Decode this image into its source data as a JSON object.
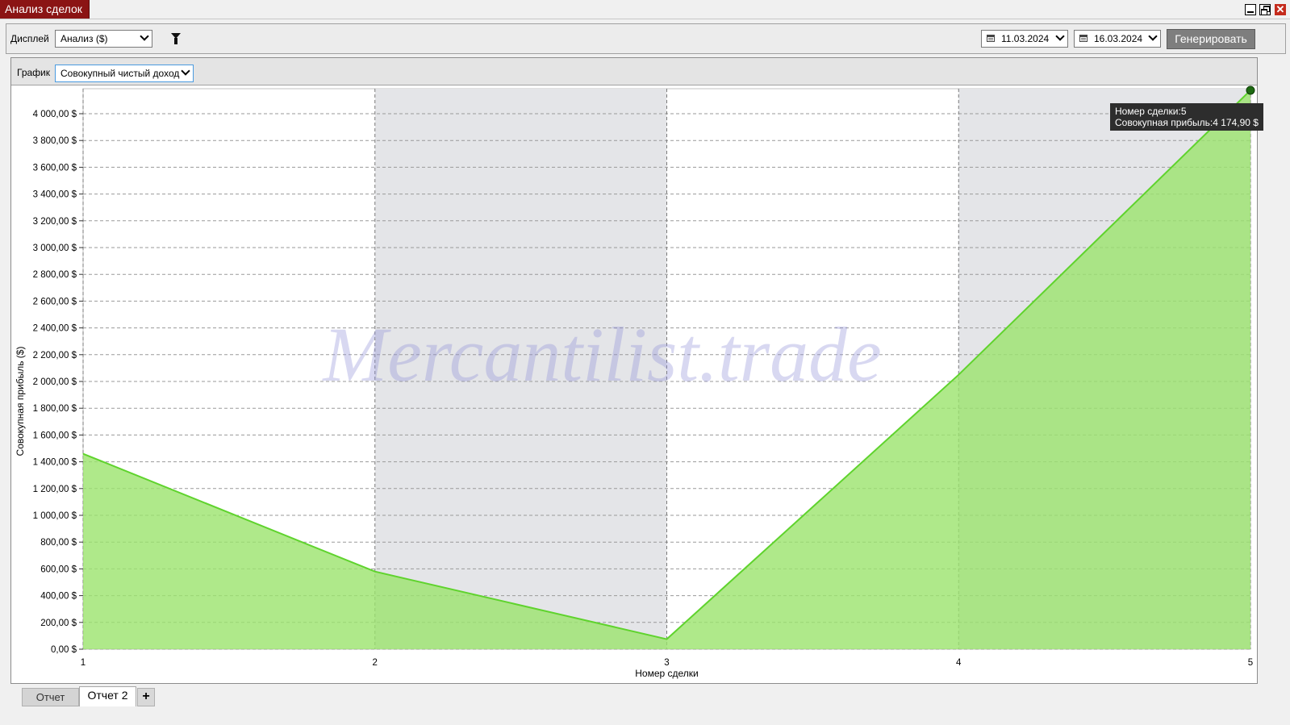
{
  "window": {
    "title": "Анализ сделок",
    "close_glyph": "✕"
  },
  "toolbar": {
    "display_label": "Дисплей",
    "display_value": "Анализ ($)",
    "date_from": "11.03.2024",
    "date_to": "16.03.2024",
    "generate_label": "Генерировать"
  },
  "chart_header": {
    "chart_label": "График",
    "chart_value": "Совокупный чистый доход"
  },
  "tooltip": {
    "line1": "Номер сделки:5",
    "line2": "Совокупная прибыль:4 174,90 $"
  },
  "watermark": "Mercantilist.trade",
  "colors": {
    "fill": "#9be36d",
    "line": "#5fd32d",
    "band": "#e4e5e8",
    "accent": "#8b1414",
    "point": "#1e6b12"
  },
  "chart_data": {
    "type": "area",
    "x": [
      1,
      2,
      3,
      4,
      5
    ],
    "series": [
      {
        "values": [
          1460,
          580,
          75,
          2050,
          4174.9
        ]
      }
    ],
    "xlabel": "Номер сделки",
    "ylabel": "Совокупная прибыль ($)",
    "ylim": [
      0,
      4000
    ],
    "xlim": [
      1,
      5
    ],
    "yticks": [
      0,
      200,
      400,
      600,
      800,
      1000,
      1200,
      1400,
      1600,
      1800,
      2000,
      2200,
      2400,
      2600,
      2800,
      3000,
      3200,
      3400,
      3600,
      3800,
      4000
    ],
    "ytick_labels": [
      "0,00 $",
      "200,00 $",
      "400,00 $",
      "600,00 $",
      "800,00 $",
      "1 000,00 $",
      "1 200,00 $",
      "1 400,00 $",
      "1 600,00 $",
      "1 800,00 $",
      "2 000,00 $",
      "2 200,00 $",
      "2 400,00 $",
      "2 600,00 $",
      "2 800,00 $",
      "3 000,00 $",
      "3 200,00 $",
      "3 400,00 $",
      "3 600,00 $",
      "3 800,00 $",
      "4 000,00 $"
    ],
    "xtick_labels": [
      "1",
      "2",
      "3",
      "4",
      "5"
    ],
    "grid": true,
    "highlighted_point": {
      "x": 5,
      "y": 4174.9
    }
  },
  "tabs": [
    {
      "label": "Отчет"
    },
    {
      "label": "Отчет 2"
    },
    {
      "label": "+"
    }
  ]
}
